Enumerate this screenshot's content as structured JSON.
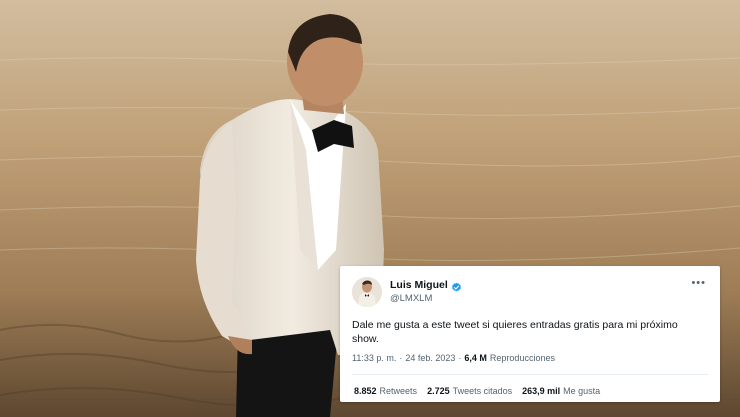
{
  "tweet": {
    "name": "Luis Miguel",
    "handle": "@LMXLM",
    "text": "Dale me gusta a este tweet si quieres entradas gratis para mi próximo show.",
    "time": "11:33 p. m.",
    "separator": "·",
    "date": "24 feb. 2023",
    "views_count": "6,4 M",
    "views_label": "Reproducciones",
    "retweets_count": "8.852",
    "retweets_label": "Retweets",
    "quotes_count": "2.725",
    "quotes_label": "Tweets citados",
    "likes_count": "263,9 mil",
    "likes_label": "Me gusta",
    "more_icon": "more-icon",
    "verified_icon": "verified-badge-icon"
  },
  "colors": {
    "verified": "#1d9bf0",
    "text_primary": "#0f1419",
    "text_secondary": "#536471"
  }
}
